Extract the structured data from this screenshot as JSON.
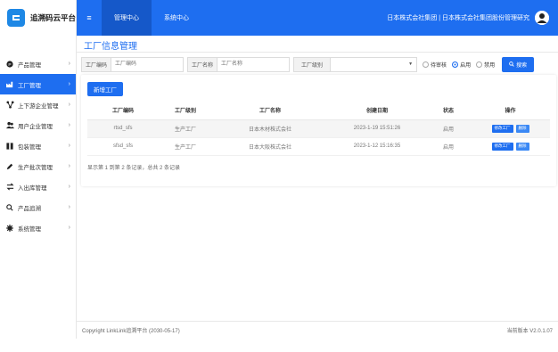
{
  "app": {
    "title": "追溯码云平台"
  },
  "sidebar": {
    "items": [
      {
        "label": "产品管理",
        "icon": "product-icon"
      },
      {
        "label": "工厂管理",
        "icon": "factory-icon",
        "active": true
      },
      {
        "label": "上下游企业管理",
        "icon": "network-icon"
      },
      {
        "label": "用户企业管理",
        "icon": "users-icon"
      },
      {
        "label": "包装管理",
        "icon": "package-icon"
      },
      {
        "label": "生产批次管理",
        "icon": "pencil-icon"
      },
      {
        "label": "入出库管理",
        "icon": "transfer-icon"
      },
      {
        "label": "产品追溯",
        "icon": "search-icon"
      },
      {
        "label": "系统管理",
        "icon": "gear-icon"
      }
    ]
  },
  "topbar": {
    "tabs": [
      {
        "label": "管理中心"
      },
      {
        "label": "系统中心"
      }
    ],
    "right_text": "日本株式会社集团 | 日本株式会社集团股份管理研究"
  },
  "page": {
    "title": "工厂信息管理"
  },
  "filters": {
    "code_label": "工厂编码",
    "code_placeholder": "工厂编码",
    "name_label": "工厂名称",
    "name_placeholder": "工厂名称",
    "level_label": "工厂级别",
    "level_value": "",
    "radios": [
      {
        "label": "待审核",
        "checked": false
      },
      {
        "label": "启用",
        "checked": true
      },
      {
        "label": "禁用",
        "checked": false
      }
    ],
    "search_label": "搜索"
  },
  "table": {
    "add_label": "新增工厂",
    "columns": [
      "工厂编码",
      "工厂级别",
      "工厂名称",
      "创建日期",
      "状态",
      "操作"
    ],
    "rows": [
      {
        "code": "rtsd_sfs",
        "level": "生产工厂",
        "name": "日本木材株式会社",
        "date": "2023-1-19 15:51:26",
        "status": "启用",
        "edit": "修改工厂",
        "delete": "删除"
      },
      {
        "code": "sfsd_sfs",
        "level": "生产工厂",
        "name": "日本大阪株式会社",
        "date": "2023-1-12 15:16:35",
        "status": "启用",
        "edit": "修改工厂",
        "delete": "删除"
      }
    ],
    "pager": "显示第 1 到第 2 条记录，总共 2 条记录"
  },
  "footer": {
    "left": "Copyright LinkLink追溯平台 (2030-05-17)",
    "right": "当前版本 V2.0.1.07"
  },
  "colors": {
    "primary": "#1e6ef0"
  }
}
